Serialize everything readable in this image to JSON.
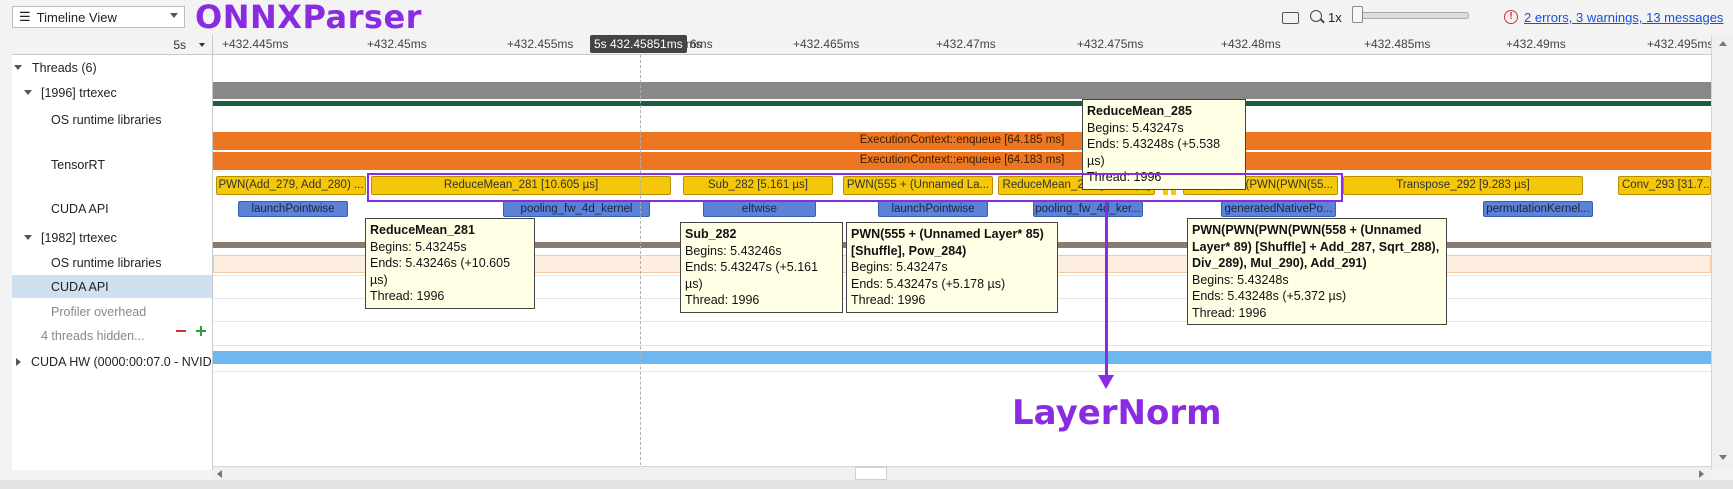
{
  "toolbar": {
    "view_select": "Timeline View",
    "zoom_level": "1x",
    "errors_link": "2 errors, 3 warnings, 13 messages"
  },
  "annotations": {
    "onnx_parser": "ONNXParser",
    "layer_norm": "LayerNorm",
    "color": "#8a2be2"
  },
  "ruler": {
    "scale": "5s",
    "ticks": [
      "+432.445ms",
      "+432.45ms",
      "+432.455ms",
      "+432.46ms",
      "+432.465ms",
      "+432.47ms",
      "+432.475ms",
      "+432.48ms",
      "+432.485ms",
      "+432.49ms",
      "+432.495ms"
    ],
    "cursor": "5s 432.45851ms",
    "cursor_tail": "6ms"
  },
  "tree": {
    "threads": "Threads (6)",
    "proc1": "[1996] trtexec",
    "os1": "OS runtime libraries",
    "tensorrt": "TensorRT",
    "cuda1": "CUDA API",
    "proc2": "[1982] trtexec",
    "os2": "OS runtime libraries",
    "cuda2": "CUDA API",
    "profiler": "Profiler overhead",
    "hidden": "4 threads hidden...",
    "cudahw": "CUDA HW (0000:00:07.0 - NVID"
  },
  "timeline": {
    "exec1": "ExecutionContext::enqueue [64.185 ms]",
    "exec2": "ExecutionContext::enqueue [64.183 ms]",
    "kernels": [
      "PWN(Add_279, Add_280) ...",
      "ReduceMean_281 [10.605 µs]",
      "Sub_282 [5.161 µs]",
      "PWN(555 + (Unnamed La...",
      "ReduceMean_285 [5.538 µs]",
      "PWN(PWN(PWN(PWN(55...",
      "Transpose_292 [9.283 µs]",
      "Conv_293 [31.7..."
    ],
    "cuda_calls": [
      "launchPointwise",
      "pooling_fw_4d_kernel",
      "eltwise",
      "launchPointwise",
      "pooling_fw_4d_ker...",
      "generatedNativePo...",
      "permutationKernel..."
    ]
  },
  "tooltips": {
    "reducemean285": {
      "title": "ReduceMean_285",
      "begins": "Begins: 5.43247s",
      "ends": "Ends: 5.43248s (+5.538 µs)",
      "thread": "Thread: 1996"
    },
    "reducemean281": {
      "title": "ReduceMean_281",
      "begins": "Begins: 5.43245s",
      "ends": "Ends: 5.43246s (+10.605 µs)",
      "thread": "Thread: 1996"
    },
    "sub282": {
      "title": "Sub_282",
      "begins": "Begins: 5.43246s",
      "ends": "Ends: 5.43247s (+5.161 µs)",
      "thread": "Thread: 1996"
    },
    "pwn555": {
      "title": "PWN(555 + (Unnamed Layer* 85) [Shuffle], Pow_284)",
      "begins": "Begins: 5.43247s",
      "ends": "Ends: 5.43247s (+5.178 µs)",
      "thread": "Thread: 1996"
    },
    "pwn558": {
      "title": "PWN(PWN(PWN(PWN(558 + (Unnamed Layer* 89) [Shuffle] + Add_287, Sqrt_288), Div_289), Mul_290), Add_291)",
      "begins": "Begins: 5.43248s",
      "ends": "Ends: 5.43248s (+5.372 µs)",
      "thread": "Thread: 1996"
    }
  },
  "colors": {
    "execution": "#ec7622",
    "kernel": "#f5c70a",
    "cuda_api": "#5b82d6",
    "cuda_hw": "#6db8f0",
    "os_runtime": "#888888",
    "selection": "#cfe0f1"
  },
  "icons": [
    "menu-icon",
    "keyboard-icon",
    "zoom-out-icon",
    "error-icon"
  ]
}
